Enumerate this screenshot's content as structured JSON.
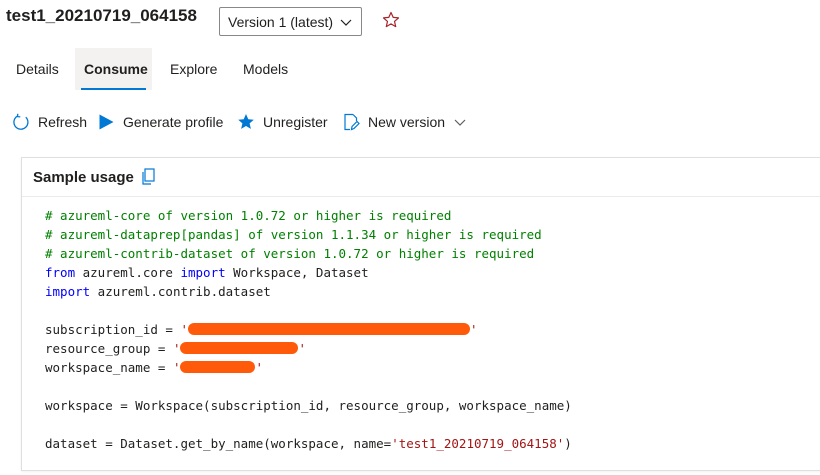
{
  "header": {
    "title": "test1_20210719_064158",
    "version_label": "Version 1 (latest)"
  },
  "tabs": [
    {
      "label": "Details"
    },
    {
      "label": "Consume"
    },
    {
      "label": "Explore"
    },
    {
      "label": "Models"
    }
  ],
  "active_tab": "Consume",
  "toolbar": {
    "refresh": "Refresh",
    "generate_profile": "Generate profile",
    "unregister": "Unregister",
    "new_version": "New version"
  },
  "card": {
    "title": "Sample usage"
  },
  "code": {
    "comment_1": "# azureml-core of version 1.0.72 or higher is required",
    "comment_2": "# azureml-dataprep[pandas] of version 1.1.34 or higher is required",
    "comment_3": "# azureml-contrib-dataset of version 1.0.72 or higher is required",
    "import_1": {
      "kw1": "from",
      "module": " azureml.core ",
      "kw2": "import",
      "names": " Workspace, Dataset"
    },
    "import_2": {
      "kw": "import",
      "module": " azureml.contrib.dataset"
    },
    "sub_prefix": "subscription_id = ",
    "rg_prefix": "resource_group = ",
    "ws_prefix": "workspace_name = ",
    "quote": "'",
    "workspace_line": "workspace = Workspace(subscription_id, resource_group, workspace_name)",
    "dataset_prefix": "dataset = Dataset.get_by_name(workspace, name=",
    "dataset_name": "'test1_20210719_064158'",
    "dataset_suffix": ")"
  },
  "colors": {
    "accent": "#0078d4",
    "comment": "#008000",
    "keyword": "#0000ff",
    "string": "#a31515",
    "redaction": "#ff5a0a",
    "favorite_star": "#a4262c"
  }
}
